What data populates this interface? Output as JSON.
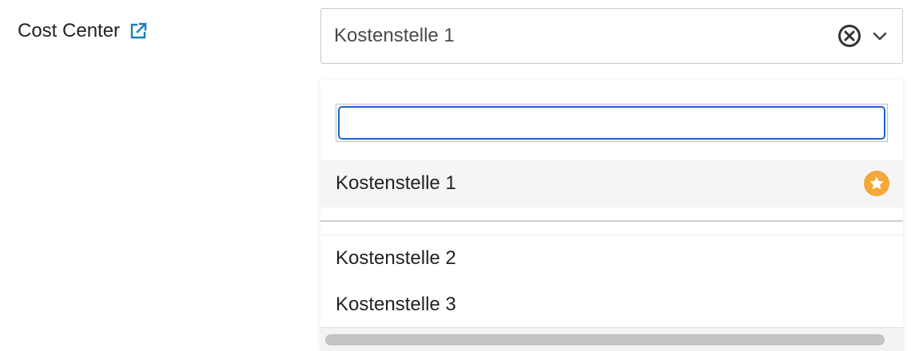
{
  "field": {
    "label": "Cost Center",
    "link_icon": "external-link-icon"
  },
  "select": {
    "value": "Kostenstelle 1",
    "clear_icon": "clear-circle-icon",
    "toggle_icon": "chevron-down-icon"
  },
  "dropdown": {
    "search": {
      "value": "",
      "placeholder": ""
    },
    "options": [
      {
        "label": "Kostenstelle 1",
        "selected": true,
        "favorite_icon": "star-icon"
      },
      {
        "label": "Kostenstelle 2",
        "selected": false
      },
      {
        "label": "Kostenstelle 3",
        "selected": false
      }
    ]
  },
  "colors": {
    "link": "#1a7fb8",
    "focus_border": "#1a64c8",
    "favorite": "#f4a83a",
    "selected_bg": "#f5f5f5"
  }
}
